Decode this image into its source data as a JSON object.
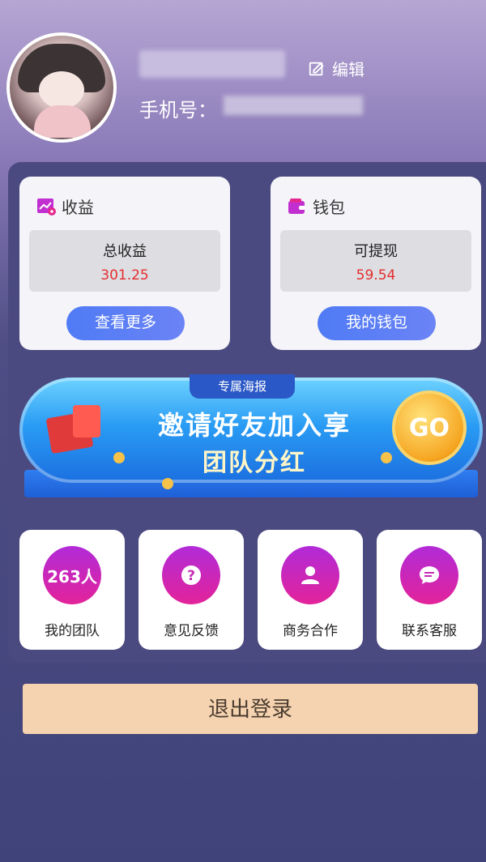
{
  "profile": {
    "edit_label": "编辑",
    "phone_label": "手机号："
  },
  "earnings_card": {
    "title": "收益",
    "stat_label": "总收益",
    "stat_value": "301.25",
    "button_label": "查看更多"
  },
  "wallet_card": {
    "title": "钱包",
    "stat_label": "可提现",
    "stat_value": "59.54",
    "button_label": "我的钱包"
  },
  "banner": {
    "tag": "专属海报",
    "line1": "邀请好友加入享",
    "line2": "团队分红",
    "go_label": "GO"
  },
  "tiles": [
    {
      "badge": "263人",
      "label": "我的团队"
    },
    {
      "label": "意见反馈"
    },
    {
      "label": "商务合作"
    },
    {
      "label": "联系客服"
    }
  ],
  "logout_label": "退出登录"
}
